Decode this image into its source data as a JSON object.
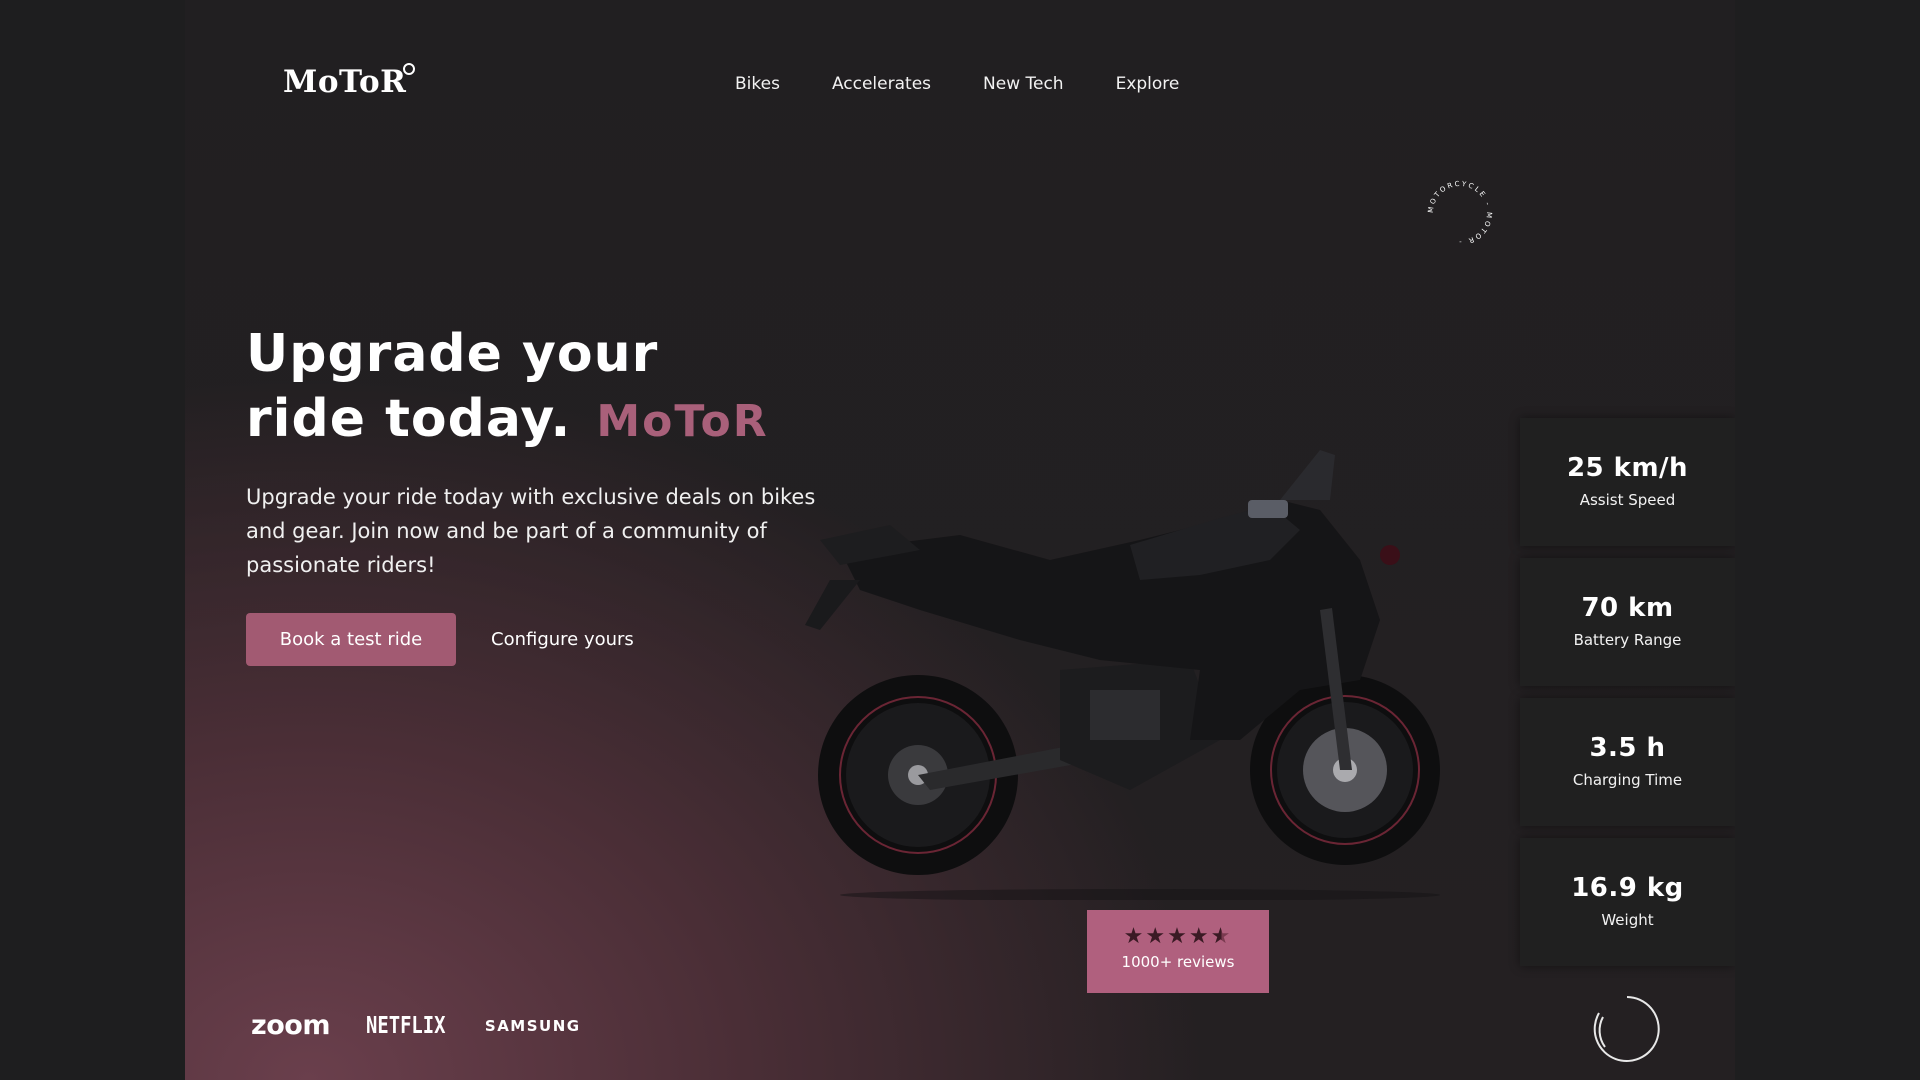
{
  "header": {
    "logo": "MoToR",
    "nav": [
      "Bikes",
      "Accelerates",
      "New Tech",
      "Explore"
    ]
  },
  "badge": {
    "ring_text": "MOTORCYCLE - MOTOR - "
  },
  "hero": {
    "title_line1": "Upgrade your",
    "title_line2": "ride today.",
    "title_brand": "MoToR",
    "description": "Upgrade your ride today with exclusive deals on bikes and gear. Join now and be part of a community of passionate riders!",
    "primary_button": "Book a test ride",
    "secondary_link": "Configure yours"
  },
  "reviews": {
    "rating": 4.5,
    "max_rating": 5,
    "label": "1000+ reviews"
  },
  "stats": [
    {
      "value": "25 km/h",
      "label": "Assist Speed"
    },
    {
      "value": "70 km",
      "label": "Battery Range"
    },
    {
      "value": "3.5 h",
      "label": "Charging Time"
    },
    {
      "value": "16.9 kg",
      "label": "Weight"
    }
  ],
  "brands": [
    "zoom",
    "NETFLIX",
    "SAMSUNG"
  ],
  "colors": {
    "accent": "#a25a72",
    "brand_text": "#a9607a",
    "background": "#1e1e1f",
    "card": "#202020"
  }
}
